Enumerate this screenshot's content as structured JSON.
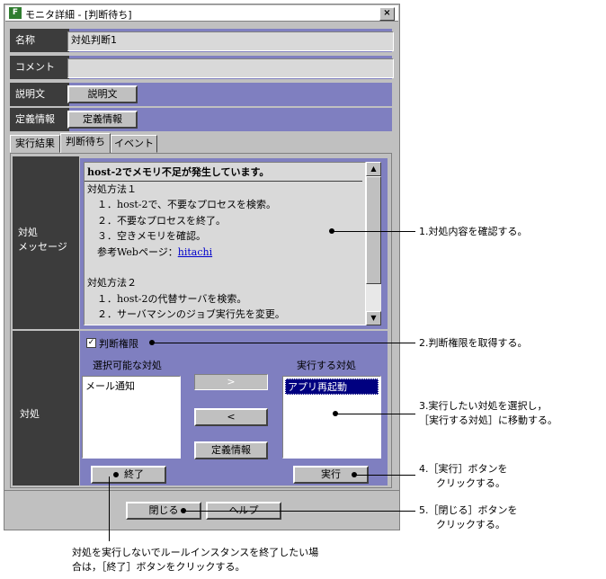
{
  "window": {
    "title": "モニタ詳細 - [判断待ち]",
    "app_icon_text": "F",
    "close_symbol": "×"
  },
  "rows": {
    "name": {
      "label": "名称",
      "value": "対処判断1"
    },
    "comment": {
      "label": "コメント",
      "value": ""
    },
    "description": {
      "label": "説明文",
      "button": "説明文"
    },
    "definition": {
      "label": "定義情報",
      "button": "定義情報"
    }
  },
  "tabs": [
    "実行結果",
    "判断待ち",
    "イベント"
  ],
  "message": {
    "side_label_line1": "対処",
    "side_label_line2": "メッセージ",
    "lines": [
      "host-2でメモリ不足が発生しています。",
      "対処方法１",
      "　１．host-2で、不要なプロセスを検索。",
      "　２．不要なプロセスを終了。",
      "　３．空きメモリを確認。",
      "　参考Webページ：",
      "",
      "対処方法２",
      "　１．host-2の代替サーバを検索。",
      "　２．サーバマシンのジョブ実行先を変更。"
    ],
    "link": "hitachi"
  },
  "action": {
    "side_label": "対処",
    "checkbox_label": "判断権限",
    "checkbox_checked": true,
    "available_header": "選択可能な対処",
    "execute_header": "実行する対処",
    "available_items": [
      "メール通知"
    ],
    "execute_items": [
      "アプリ再起動"
    ],
    "move_right": ">",
    "move_left": "<",
    "definition_button": "定義情報",
    "end_button": "終了",
    "run_button": "実行"
  },
  "footer": {
    "close_button": "閉じる",
    "help_button": "ヘルプ"
  },
  "annotations": {
    "a1": "1.対処内容を確認する。",
    "a2": "2.判断権限を取得する。",
    "a3_line1": "3.実行したい対処を選択し，",
    "a3_line2": "［実行する対処］に移動する。",
    "a4_line1": "4.［実行］ボタンを",
    "a4_line2": "クリックする。",
    "a5_line1": "5.［閉じる］ボタンを",
    "a5_line2": "クリックする。",
    "bottom_line1": "対処を実行しないでルールインスタンスを終了したい場",
    "bottom_line2": "合は，［終了］ボタンをクリックする。"
  },
  "colors": {
    "panel": "#7f7fc0",
    "label_bg": "#3c3c3c",
    "window": "#c0c0c0"
  }
}
